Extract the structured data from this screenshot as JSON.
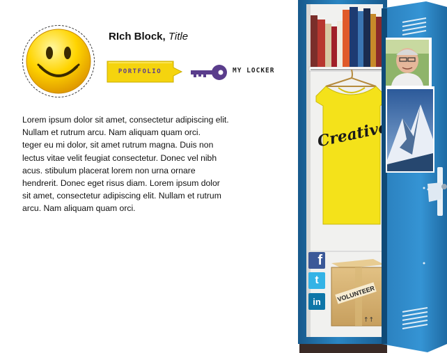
{
  "profile": {
    "name": "RIch Block,",
    "title": "Title",
    "portfolio_label": "PORTFOLIO",
    "locker_label": "MY LOCKER",
    "bio": "Lorem ipsum dolor sit amet, consectetur adipiscing elit.\nNullam et rutrum arcu. Nam aliquam quam orci.\nteger eu mi dolor, sit amet rutrum magna. Duis non\nlectus vitae velit feugiat consectetur. Donec vel nibh\nacus. stibulum placerat lorem non urna ornare\n hendrerit. Donec eget risus diam. Lorem ipsum dolor\nsit amet, consectetur adipiscing elit. Nullam et rutrum\narcu. Nam aliquam quam orci."
  },
  "locker": {
    "shirt_text": "Creative",
    "box_label": "VOLUNTEER",
    "social": [
      {
        "name": "facebook",
        "glyph": "f"
      },
      {
        "name": "twitter",
        "glyph": "t"
      },
      {
        "name": "linkedin",
        "glyph": "in"
      }
    ]
  },
  "colors": {
    "locker_blue": "#1f6fa6",
    "button_yellow": "#f5d40e",
    "key_purple": "#5a3d8c",
    "shirt_yellow": "#f4e21a"
  }
}
